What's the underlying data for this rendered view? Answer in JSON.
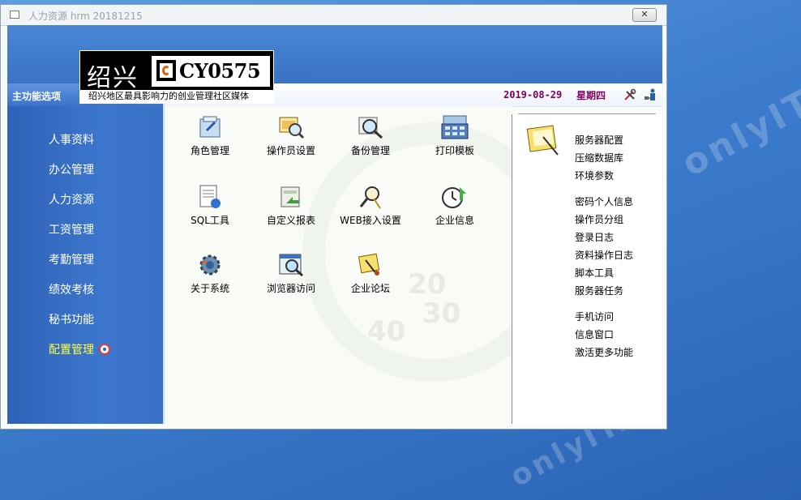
{
  "window": {
    "title": "人力资源 hrm 20181215",
    "close_label": "✕"
  },
  "desktop": {
    "watermark": "onlyIT.cn"
  },
  "logo": {
    "city": "绍兴",
    "code": "CY0575",
    "tagline": "绍兴地区最具影响力的创业管理社区媒体"
  },
  "sidebar": {
    "title": "主功能选项",
    "items": [
      {
        "label": "人事资料"
      },
      {
        "label": "办公管理"
      },
      {
        "label": "人力资源"
      },
      {
        "label": "工资管理"
      },
      {
        "label": "考勤管理"
      },
      {
        "label": "绩效考核"
      },
      {
        "label": "秘书功能"
      },
      {
        "label": "配置管理",
        "active": true
      }
    ]
  },
  "infobar": {
    "date": "2019-08-29",
    "weekday": "星期四",
    "icons": [
      "tools-icon",
      "user-network-icon"
    ]
  },
  "tiles": [
    {
      "label": "角色管理",
      "icon": "role-icon"
    },
    {
      "label": "操作员设置",
      "icon": "operator-icon"
    },
    {
      "label": "备份管理",
      "icon": "backup-icon"
    },
    {
      "label": "打印模板",
      "icon": "calculator-icon"
    },
    {
      "label": "SQL工具",
      "icon": "sql-icon"
    },
    {
      "label": "自定义报表",
      "icon": "report-icon"
    },
    {
      "label": "WEB接入设置",
      "icon": "web-icon"
    },
    {
      "label": "企业信息",
      "icon": "clock-icon"
    },
    {
      "label": "关于系统",
      "icon": "gear-icon"
    },
    {
      "label": "浏览器访问",
      "icon": "browser-icon"
    },
    {
      "label": "企业论坛",
      "icon": "forum-icon"
    }
  ],
  "right_links": {
    "group1": [
      "服务器配置",
      "压缩数据库",
      "环境参数"
    ],
    "group2": [
      "密码个人信息",
      "操作员分组",
      "登录日志",
      "资料操作日志",
      "脚本工具",
      "服务器任务"
    ],
    "group3": [
      "手机访问",
      "信息窗口",
      "激活更多功能"
    ]
  },
  "colors": {
    "sidebar": "#3a70c4",
    "active_nav": "#ffff40",
    "date_text": "#800060"
  }
}
